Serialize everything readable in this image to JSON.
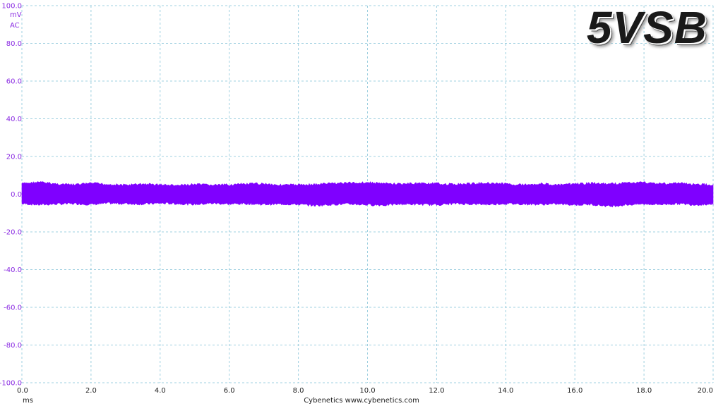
{
  "chart_data": {
    "type": "area",
    "title": "5VSB",
    "ylabel": "mV",
    "ylabel_mode": "AC",
    "xlabel": "ms",
    "footer": "Cybenetics   www.cybenetics.com",
    "xlim": [
      0,
      20
    ],
    "ylim": [
      -100,
      100
    ],
    "x_ticks": [
      "0.0",
      "2.0",
      "4.0",
      "6.0",
      "8.0",
      "10.0",
      "12.0",
      "14.0",
      "16.0",
      "18.0",
      "20.0"
    ],
    "y_ticks": [
      "100.0",
      "80.0",
      "60.0",
      "40.0",
      "20.0",
      "0.0",
      "-20.0",
      "-40.0",
      "-60.0",
      "-80.0",
      "-100.0"
    ],
    "grid": true,
    "series": [
      {
        "color": "#7f00ff",
        "x": [
          0,
          0.5,
          1,
          1.5,
          2,
          2.5,
          3,
          3.5,
          4,
          4.5,
          5,
          5.5,
          6,
          6.5,
          7,
          7.5,
          8,
          8.5,
          9,
          9.5,
          10,
          10.5,
          11,
          11.5,
          12,
          12.5,
          13,
          13.5,
          14,
          14.5,
          15,
          15.5,
          16,
          16.5,
          17,
          17.5,
          18,
          18.5,
          19,
          19.5,
          20
        ],
        "upper": [
          6.2,
          7.0,
          6.0,
          5.6,
          6.4,
          5.8,
          5.4,
          6.0,
          5.6,
          5.2,
          5.8,
          5.4,
          5.6,
          6.0,
          6.2,
          5.4,
          5.6,
          5.8,
          6.4,
          6.6,
          6.8,
          6.2,
          6.0,
          6.4,
          6.2,
          5.8,
          6.2,
          6.6,
          6.0,
          5.6,
          6.2,
          5.4,
          6.0,
          6.4,
          6.0,
          6.6,
          6.8,
          6.2,
          6.4,
          5.8,
          5.6
        ],
        "lower": [
          -5.6,
          -6.2,
          -5.8,
          -5.6,
          -6.0,
          -5.4,
          -5.6,
          -5.8,
          -5.4,
          -5.6,
          -6.0,
          -5.4,
          -5.8,
          -5.6,
          -6.0,
          -5.8,
          -6.0,
          -6.6,
          -6.0,
          -5.8,
          -6.2,
          -6.4,
          -5.8,
          -6.0,
          -6.2,
          -5.6,
          -5.8,
          -6.0,
          -5.6,
          -5.8,
          -6.0,
          -5.8,
          -6.2,
          -6.0,
          -7.0,
          -6.2,
          -5.8,
          -6.0,
          -5.6,
          -6.2,
          -5.8
        ]
      }
    ]
  }
}
